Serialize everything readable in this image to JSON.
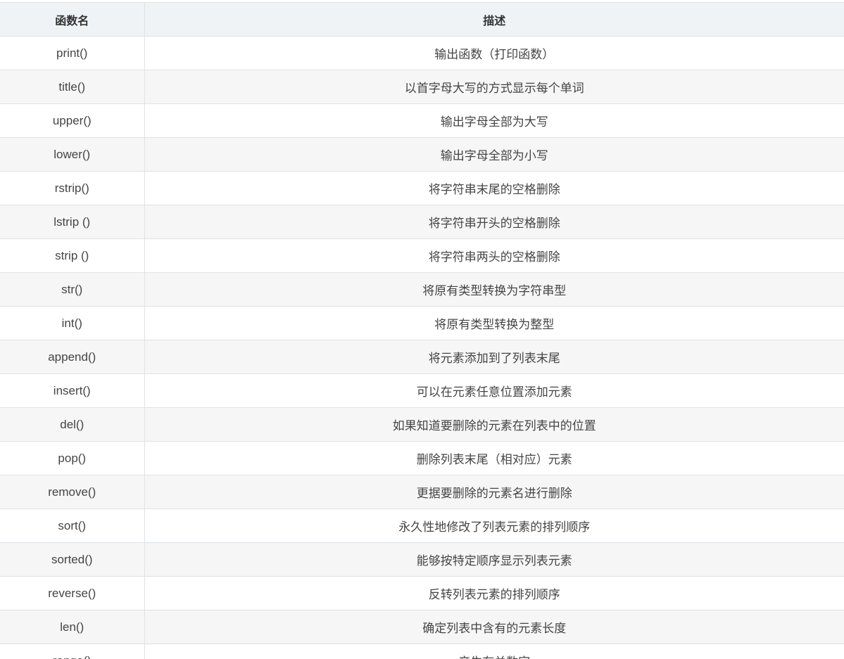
{
  "table": {
    "headers": [
      "函数名",
      "描述"
    ],
    "rows": [
      {
        "fn": "print()",
        "desc": "输出函数（打印函数）"
      },
      {
        "fn": "title()",
        "desc": "以首字母大写的方式显示每个单词"
      },
      {
        "fn": "upper()",
        "desc": "输出字母全部为大写"
      },
      {
        "fn": "lower()",
        "desc": "输出字母全部为小写"
      },
      {
        "fn": "rstrip()",
        "desc": "将字符串末尾的空格删除"
      },
      {
        "fn": "lstrip ()",
        "desc": "将字符串开头的空格删除"
      },
      {
        "fn": "strip ()",
        "desc": "将字符串两头的空格删除"
      },
      {
        "fn": "str()",
        "desc": "将原有类型转换为字符串型"
      },
      {
        "fn": "int()",
        "desc": "将原有类型转换为整型"
      },
      {
        "fn": "append()",
        "desc": "将元素添加到了列表末尾"
      },
      {
        "fn": "insert()",
        "desc": "可以在元素任意位置添加元素"
      },
      {
        "fn": "del()",
        "desc": "如果知道要删除的元素在列表中的位置"
      },
      {
        "fn": "pop()",
        "desc": "删除列表末尾（相对应）元素"
      },
      {
        "fn": "remove()",
        "desc": "更据要删除的元素名进行删除"
      },
      {
        "fn": "sort()",
        "desc": "永久性地修改了列表元素的排列顺序"
      },
      {
        "fn": "sorted()",
        "desc": "能够按特定顺序显示列表元素"
      },
      {
        "fn": "reverse()",
        "desc": "反转列表元素的排列顺序"
      },
      {
        "fn": "len()",
        "desc": "确定列表中含有的元素长度"
      },
      {
        "fn": "range()",
        "desc": "产生有关数字"
      }
    ]
  }
}
